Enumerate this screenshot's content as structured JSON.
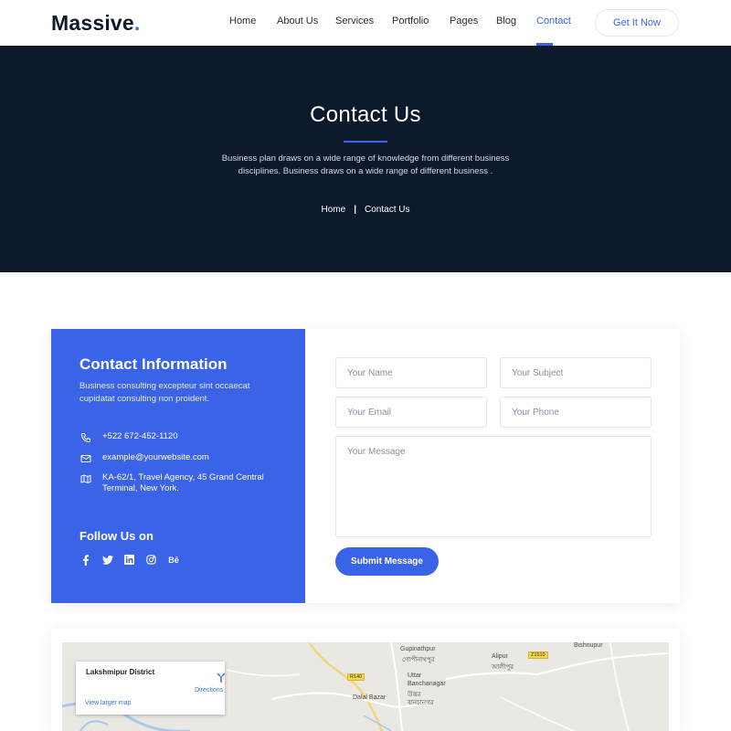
{
  "header": {
    "logo": "Massive",
    "logo_dot": ".",
    "nav": [
      "Home",
      "About Us",
      "Services",
      "Portfolio",
      "Pages",
      "Blog",
      "Contact"
    ],
    "active_nav": "Contact",
    "cta": "Get It Now"
  },
  "hero": {
    "title": "Contact Us",
    "description": "Business plan draws on a wide range of knowledge from different business disciplines. Business draws on a wide range of different business .",
    "breadcrumb_home": "Home",
    "breadcrumb_sep": "|",
    "breadcrumb_current": "Contact Us"
  },
  "contact_info": {
    "title": "Contact Information",
    "description": "Business consulting excepteur sint occaecat cupidatat consulting non proident.",
    "phone": "+522 672-452-1120",
    "email": "example@yourwebsite.com",
    "address": "KA-62/1, Travel Agency, 45 Grand Central Terminal, New York.",
    "follow_title": "Follow Us on",
    "socials": [
      "facebook-icon",
      "twitter-icon",
      "linkedin-icon",
      "instagram-icon",
      "behance-icon"
    ],
    "behance_text": "Bē"
  },
  "form": {
    "name_placeholder": "Your Name",
    "subject_placeholder": "Your Subject",
    "email_placeholder": "Your Email",
    "phone_placeholder": "Your Phone",
    "message_placeholder": "Your Message",
    "submit_label": "Submit Message"
  },
  "map": {
    "place": "Lakshmipur District",
    "directions": "Directions",
    "view_larger": "View larger map",
    "labels": [
      "Gupinathpur",
      "গোপীনাথপুর",
      "Uttar",
      "Banchanagar",
      "উত্তর",
      "বানচানগর",
      "Alipur",
      "আলীপুর",
      "Dalal Bazar",
      "Bishnupur"
    ],
    "road_badges": [
      "R140",
      "Z1510"
    ]
  },
  "colors": {
    "accent": "#3a63e8",
    "hero_bg": "#0c1a2c"
  }
}
